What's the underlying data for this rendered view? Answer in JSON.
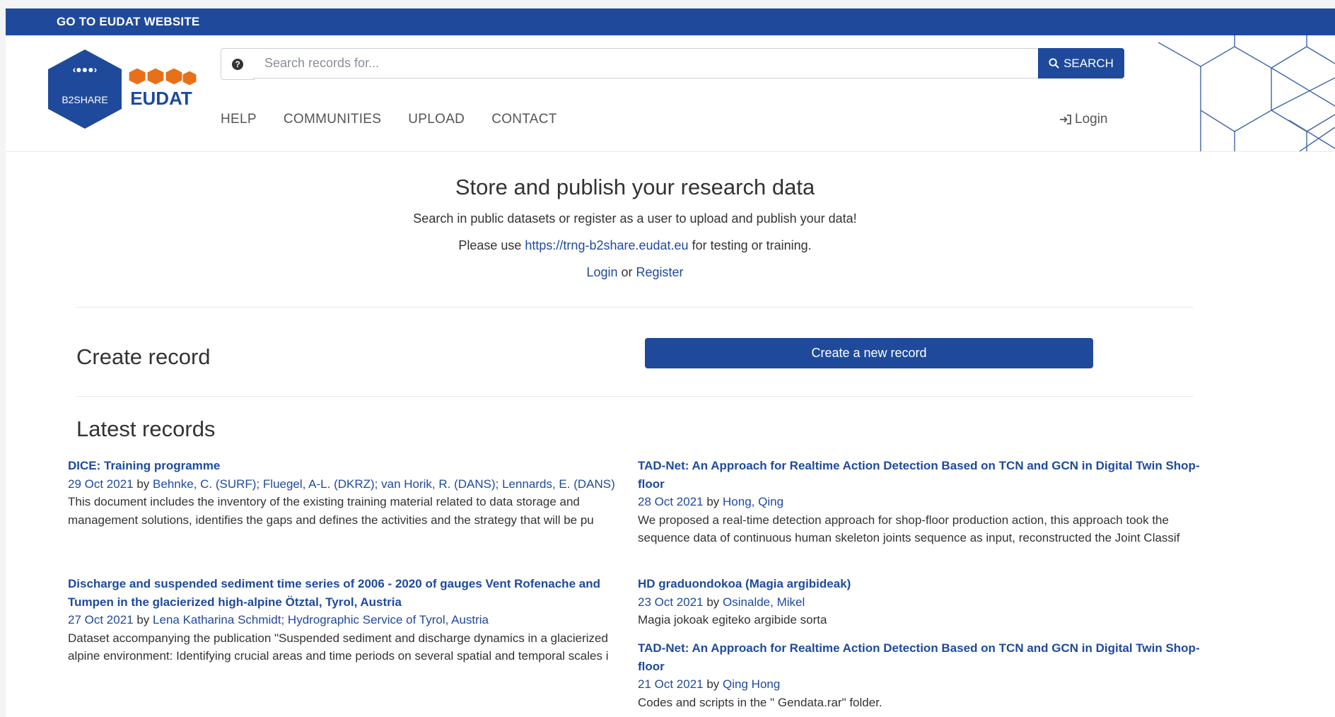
{
  "topbar": {
    "link": "GO TO EUDAT WEBSITE"
  },
  "logos": {
    "b2share": "B2SHARE",
    "eudat": "EUDAT"
  },
  "search": {
    "placeholder": "Search records for...",
    "help_icon": "question-circle-icon",
    "button": "SEARCH",
    "button_icon": "search-icon"
  },
  "nav": {
    "items": [
      "HELP",
      "COMMUNITIES",
      "UPLOAD",
      "CONTACT"
    ],
    "login": "Login",
    "login_icon": "sign-in-icon"
  },
  "hero": {
    "title": "Store and publish your research data",
    "line1": "Search in public datasets or register as a user to upload and publish your data!",
    "line2_pre": "Please use ",
    "line2_link": "https://trng-b2share.eudat.eu",
    "line2_post": " for testing or training.",
    "login": "Login",
    "or": " or ",
    "register": "Register"
  },
  "create": {
    "heading": "Create record",
    "button": "Create a new record"
  },
  "latest": {
    "heading": "Latest records",
    "by": " by ",
    "records": [
      {
        "title": "DICE: Training programme",
        "date": "29 Oct 2021",
        "authors": "Behnke, C. (SURF); Fluegel, A-L. (DKRZ); van Horik, R. (DANS); Lennards, E. (DANS)",
        "description": "This document includes the inventory of the existing training material related to data storage and management solutions, identifies the gaps and defines the activities and the strategy that will be pu"
      },
      {
        "title": "TAD-Net: An Approach for Realtime Action Detection Based on TCN and GCN in Digital Twin Shop-floor",
        "date": "28 Oct 2021",
        "authors": "Hong, Qing",
        "description": "We proposed a real-time detection approach for shop-floor production action, this approach took the sequence data of continuous human skeleton joints sequence as input, reconstructed the Joint Classif"
      },
      {
        "title": "Discharge and suspended sediment time series of 2006 - 2020 of gauges Vent Rofenache and Tumpen in the glacierized high-alpine Ötztal, Tyrol, Austria",
        "date": "27 Oct 2021",
        "authors": "Lena Katharina Schmidt; Hydrographic Service of Tyrol, Austria",
        "description": "Dataset accompanying the publication \"Suspended sediment and discharge dynamics in a glacierized alpine environment: Identifying crucial areas and time periods on several spatial and temporal scales i"
      },
      {
        "title": "HD graduondokoa (Magia argibideak)",
        "date": "23 Oct 2021",
        "authors": "Osinalde, Mikel",
        "description": "Magia jokoak egiteko argibide sorta"
      },
      {
        "title": "TAD-Net: An Approach for Realtime Action Detection Based on TCN and GCN in Digital Twin Shop-floor",
        "date": "21 Oct 2021",
        "authors": "Qing Hong",
        "description": "Codes and scripts in the \" Gendata.rar\" folder."
      }
    ]
  },
  "colors": {
    "brand": "#1f4a9c",
    "text": "#333333",
    "orange": "#e8701a"
  }
}
